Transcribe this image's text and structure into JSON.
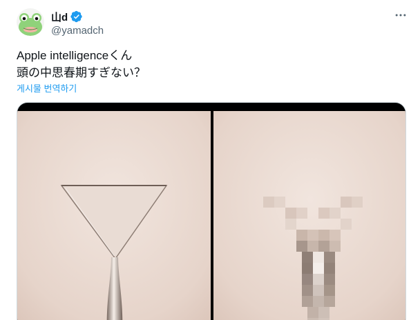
{
  "author": {
    "display_name": "山d",
    "handle": "@yamadch",
    "avatar_icon": "frog-avatar-icon",
    "verified_icon": "verified-badge-icon"
  },
  "tweet": {
    "lines": [
      "Apple intelligenceくん",
      "頭の中思春期すぎない？"
    ],
    "translate_label": "게시물 번역하기"
  },
  "menu": {
    "more_icon": "more-dots-icon"
  },
  "colors": {
    "accent": "#1d9bf0",
    "text_primary": "#0f1419",
    "text_secondary": "#536471",
    "skin": "#eadbd3"
  },
  "media": {
    "images": [
      {
        "description_icon": "martini-glass-image"
      },
      {
        "description_icon": "pixelated-image"
      }
    ]
  }
}
